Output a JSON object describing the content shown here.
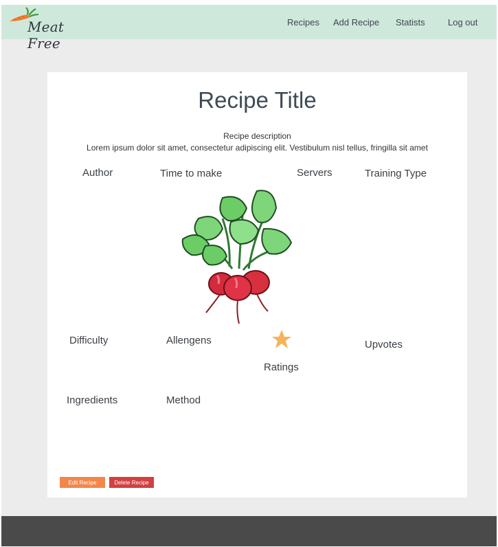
{
  "brand": {
    "name": "Meat Free",
    "logo_icon": "carrot-icon"
  },
  "nav": {
    "items": [
      {
        "label": "Recipes"
      },
      {
        "label": "Add Recipe"
      },
      {
        "label": "Statists"
      },
      {
        "label": "Log out"
      }
    ]
  },
  "recipe": {
    "title": "Recipe Title",
    "description_label": "Recipe description",
    "description": "Lorem ipsum dolor sit amet, consectetur adipiscing elit. Vestibulum nisl tellus, fringilla sit amet",
    "author_label": "Author",
    "time_label": "Time to make",
    "servers_label": "Servers",
    "training_type_label": "Training Type",
    "difficulty_label": "Difficulty",
    "allergens_label": "Allengens",
    "ratings_label": "Ratings",
    "upvotes_label": "Upvotes",
    "ingredients_label": "Ingredients",
    "method_label": "Method",
    "image_icon": "radish-icon",
    "rating_icon": "star-icon"
  },
  "actions": {
    "edit_label": "Edit Recipe",
    "delete_label": "Delete Recipe"
  },
  "colors": {
    "navbar": "#cfe8dc",
    "edit": "#f3874b",
    "delete": "#d24040",
    "star": "#f6b35a",
    "footer": "#4a4a4a"
  }
}
